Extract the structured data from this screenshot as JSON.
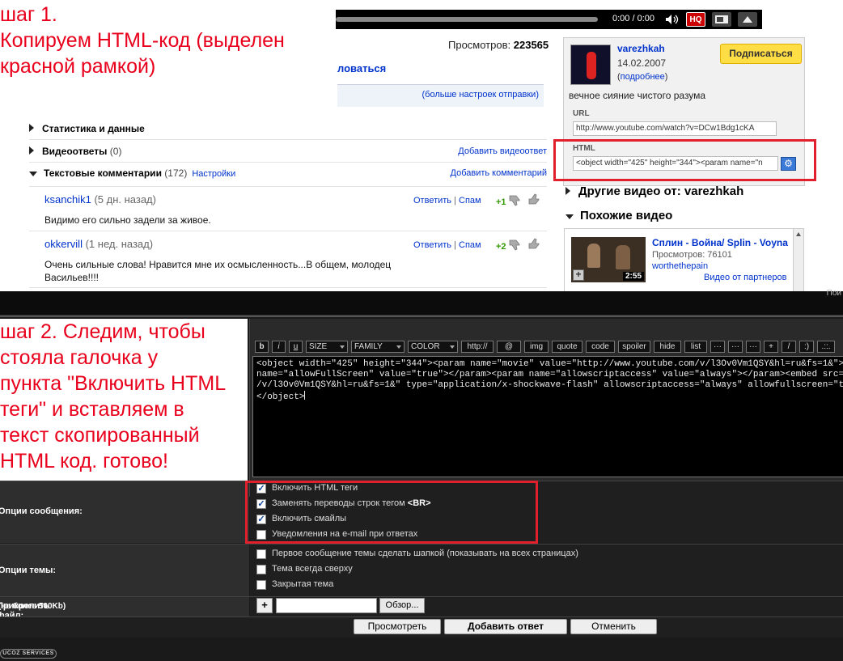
{
  "colors": {
    "accent_red": "#e0202c",
    "link_blue": "#0033cc",
    "subscribe_yellow": "#ffdd44"
  },
  "step1": {
    "lines": [
      "шаг 1.",
      "Копируем HTML-код (выделен",
      "красной рамкой)"
    ]
  },
  "player": {
    "time": "0:00 / 0:00",
    "hq_label": "HQ",
    "volume_icon": "speaker-icon",
    "wide_icon": "widescreen-icon",
    "fullscreen_icon": "fullscreen-icon"
  },
  "video_stats": {
    "views_label": "Просмотров:",
    "views_value": "223565"
  },
  "share": {
    "link": "ловаться",
    "more_settings": "(больше настроек отправки)"
  },
  "sections": {
    "stats": {
      "label": "Статистика и данные"
    },
    "video_responses": {
      "label": "Видеоответы",
      "count": "(0)",
      "action": "Добавить видеоответ"
    },
    "text_comments": {
      "label": "Текстовые комментарии",
      "count": "(172)",
      "settings": "Настройки",
      "action": "Добавить комментарий"
    }
  },
  "comments": [
    {
      "author": "ksanchik1",
      "ago": "(5 дн. назад)",
      "text": "Видимо его сильно задели за живое.",
      "reply": "Ответить",
      "sep": "|",
      "spam": "Спам",
      "score": "+1"
    },
    {
      "author": "okkervill",
      "ago": "(1 нед. назад)",
      "text_line1": "Очень сильные слова! Нравится мне их осмысленность...В общем, молодец",
      "text_line2": "Васильев!!!!",
      "reply": "Ответить",
      "sep": "|",
      "spam": "Спам",
      "score": "+2"
    }
  ],
  "channel": {
    "username": "varezhkah",
    "date": "14.02.2007",
    "more_open": "(",
    "more": "подробнее",
    "more_close": ")",
    "subscribe": "Подписаться",
    "description": "вечное сияние чистого разума",
    "url_label": "URL",
    "url_value": "http://www.youtube.com/watch?v=DCw1Bdg1cKA",
    "html_label": "HTML",
    "html_value": "<object width=\"425\" height=\"344\"><param name=\"n",
    "gear_icon": "gear-icon"
  },
  "right_sections": {
    "other": "Другие видео от: varezhkah",
    "related": "Похожие видео"
  },
  "related_video": {
    "title": "Сплин - Война/ Splin - Voyna",
    "views": "Просмотров: 76101",
    "user": "worthethepain",
    "partner": "Видео от партнеров",
    "duration": "2:55",
    "add_icon": "plus-icon"
  },
  "forum_top": {
    "partial_text": "Пои"
  },
  "step2": {
    "lines": [
      "шаг 2. Следим, чтобы",
      "стояла галочка у",
      "пункта \"Включить HTML",
      "теги\" и вставляем в",
      "текст скопированный",
      "HTML код. готово!"
    ]
  },
  "toolbar": [
    "b",
    "i",
    "u",
    "SIZE",
    "FAMILY",
    "COLOR",
    "http://",
    "@",
    "img",
    "quote",
    "code",
    "spoiler",
    "hide",
    "list",
    "···",
    "···",
    "···",
    "+",
    "/",
    ":)",
    ".::."
  ],
  "editor": {
    "line1": "<object width=\"425\" height=\"344\"><param name=\"movie\" value=\"http://www.youtube.com/v/l3Ov0Vm1QSY&hl=ru&fs=1&\"></param><param",
    "line2": "name=\"allowFullScreen\" value=\"true\"></param><param name=\"allowscriptaccess\" value=\"always\"></param><embed src=\"http://www.youtube.com",
    "line3": "/v/l3Ov0Vm1QSY&hl=ru&fs=1&\" type=\"application/x-shockwave-flash\" allowscriptaccess=\"always\" allowfullscreen=\"true\" width=\"425\" height=\"344\"></embed>",
    "line4": "</object>"
  },
  "message_options": {
    "label": "Опции сообщения:",
    "items": [
      {
        "text": "Включить HTML теги",
        "checked": true
      },
      {
        "text": "Заменять переводы строк тегом",
        "tag": "<BR>",
        "checked": true
      },
      {
        "text": "Включить смайлы",
        "checked": true
      },
      {
        "text": "Уведомления на e-mail при ответах",
        "checked": false
      }
    ]
  },
  "topic_options": {
    "label": "Опции темы:",
    "items": [
      {
        "text": "Первое сообщение темы сделать шапкой (показывать на всех страницах)",
        "checked": false
      },
      {
        "text": "Тема всегда сверху",
        "checked": false
      },
      {
        "text": "Закрытая тема",
        "checked": false
      }
    ]
  },
  "attach": {
    "label": "Прикрепить файл:",
    "note": "(не более 500Kb)",
    "plus": "+",
    "browse": "Обзор..."
  },
  "buttons": {
    "preview": "Просмотреть",
    "submit": "Добавить ответ",
    "cancel": "Отменить"
  },
  "footer": {
    "ucoz": "UCOZ SERVICES"
  }
}
